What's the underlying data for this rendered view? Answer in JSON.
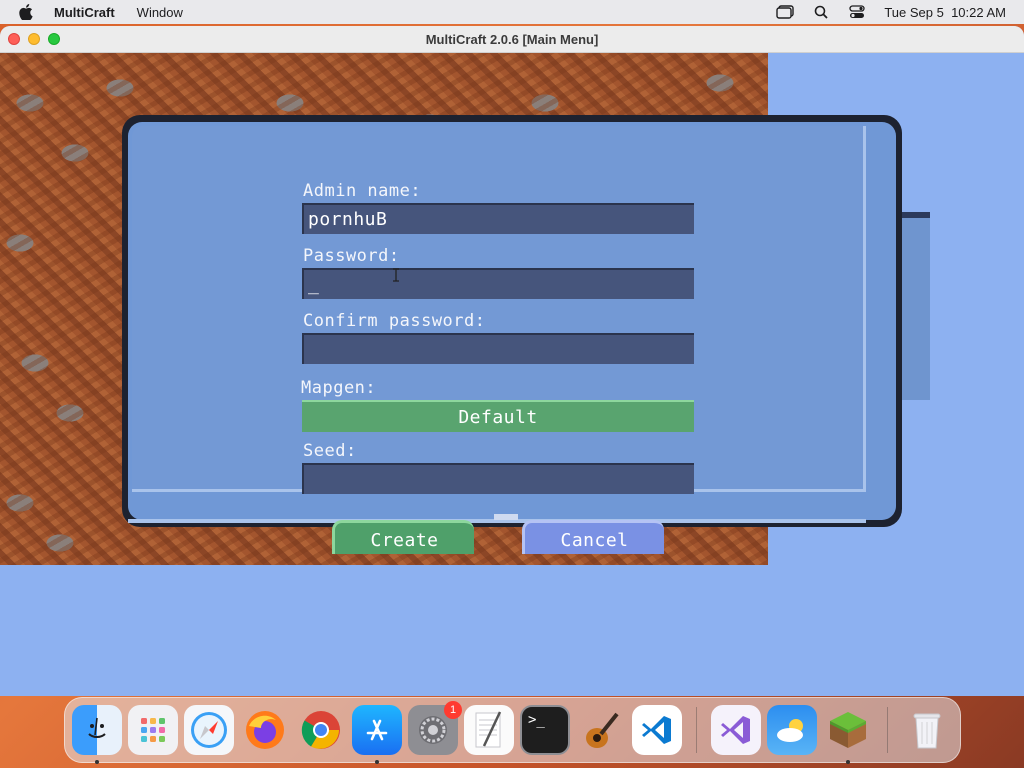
{
  "menubar": {
    "app_name": "MultiCraft",
    "menu_items": [
      "Window"
    ],
    "datetime": "Tue Sep 5  10:22 AM"
  },
  "window": {
    "title": "MultiCraft 2.0.6 [Main Menu]"
  },
  "dialog": {
    "admin_label": "Admin name:",
    "admin_value": "pornhuB",
    "password_label": "Password:",
    "password_value": "_",
    "confirm_label": "Confirm password:",
    "confirm_value": "",
    "mapgen_label": "Mapgen:",
    "mapgen_value": "Default",
    "seed_label": "Seed:",
    "seed_value": "",
    "create_label": "Create",
    "cancel_label": "Cancel"
  },
  "dock": {
    "items": [
      {
        "name": "finder-icon",
        "running": true
      },
      {
        "name": "launchpad-icon",
        "running": false
      },
      {
        "name": "safari-icon",
        "running": false
      },
      {
        "name": "firefox-icon",
        "running": false
      },
      {
        "name": "chrome-icon",
        "running": false
      },
      {
        "name": "app-store-icon",
        "running": true
      },
      {
        "name": "system-settings-icon",
        "running": false,
        "badge": "1"
      },
      {
        "name": "textedit-icon",
        "running": false
      },
      {
        "name": "terminal-icon",
        "running": false
      },
      {
        "name": "garageband-icon",
        "running": false
      },
      {
        "name": "vscode-icon",
        "running": false
      },
      {
        "name": "visual-studio-icon",
        "running": false
      },
      {
        "name": "weather-icon",
        "running": false
      },
      {
        "name": "multicraft-icon",
        "running": true
      },
      {
        "name": "trash-icon",
        "running": false
      }
    ]
  },
  "colors": {
    "dialog_bg": "#7098d6",
    "field_bg": "#46557c",
    "create_green": "#4fa06a",
    "cancel_blue": "#7a91e4",
    "sky": "#8db1f1"
  }
}
